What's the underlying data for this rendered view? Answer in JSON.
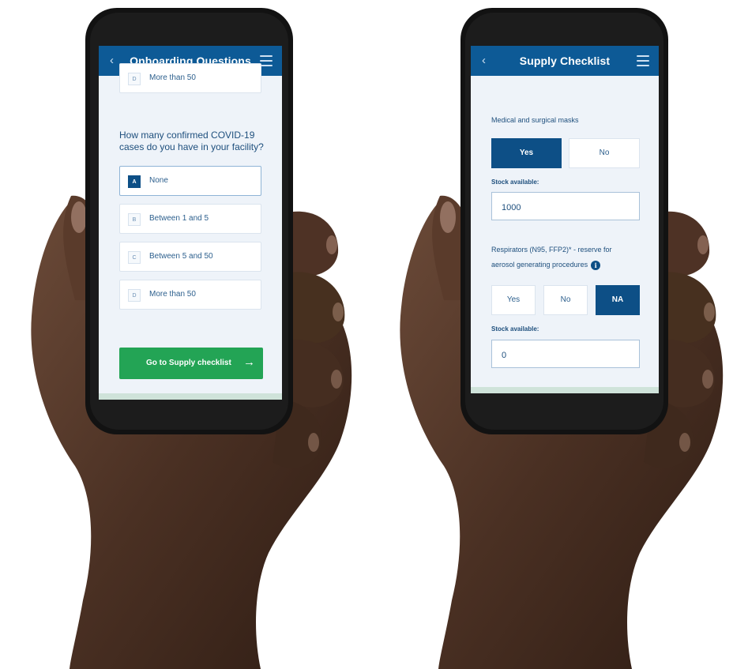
{
  "left_phone": {
    "nav": {
      "back_icon": "chevron-left-icon",
      "back_glyph": "‹",
      "title": "Onboarding Questions",
      "menu_icon": "menu-icon"
    },
    "prev_option": {
      "key": "D",
      "label": "More than 50"
    },
    "question": "How many confirmed COVID-19 cases do you have in your facility?",
    "options": [
      {
        "key": "A",
        "label": "None",
        "selected": true
      },
      {
        "key": "B",
        "label": "Between 1 and 5",
        "selected": false
      },
      {
        "key": "C",
        "label": "Between 5 and 50",
        "selected": false
      },
      {
        "key": "D",
        "label": "More than 50",
        "selected": false
      }
    ],
    "cta": {
      "label": "Go to Supply checklist",
      "arrow": "→",
      "color": "#23a455"
    }
  },
  "right_phone": {
    "nav": {
      "back_icon": "chevron-left-icon",
      "back_glyph": "‹",
      "title": "Supply Checklist",
      "menu_icon": "menu-icon"
    },
    "item1": {
      "label": "Medical and surgical masks",
      "yes": "Yes",
      "no": "No",
      "selected": "Yes",
      "stock_label": "Stock available:",
      "stock_value": "1000"
    },
    "item2": {
      "label_line1": "Respirators (N95, FFP2)* - reserve for",
      "label_line2": "aerosol generating procedures",
      "info_icon": "info-icon",
      "info_glyph": "i",
      "yes": "Yes",
      "no": "No",
      "na": "NA",
      "selected": "NA",
      "stock_label": "Stock available:",
      "stock_value": "0"
    }
  },
  "colors": {
    "nav": "#0d5a96",
    "selected": "#0d4f86",
    "screen_bg": "#eef3f9"
  }
}
